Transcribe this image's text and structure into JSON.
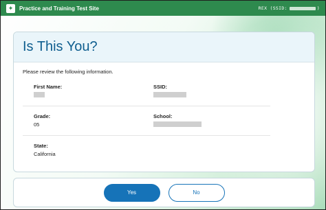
{
  "header": {
    "site_title": "Practice and Training Test Site",
    "user_label": "REX (SSID:",
    "user_suffix": ")",
    "logo_icon": "leaf-logo-icon"
  },
  "card": {
    "title": "Is This You?",
    "intro": "Please review the following information.",
    "fields": {
      "first_name": {
        "label": "First Name:",
        "value": ""
      },
      "ssid": {
        "label": "SSID:",
        "value": ""
      },
      "grade": {
        "label": "Grade:",
        "value": "05"
      },
      "school": {
        "label": "School:",
        "value": ""
      },
      "state": {
        "label": "State:",
        "value": "California"
      }
    }
  },
  "footer": {
    "yes_label": "Yes",
    "no_label": "No"
  },
  "colors": {
    "brand_green": "#2e8a4e",
    "title_blue": "#0f5e8f",
    "button_blue": "#1673b8"
  }
}
